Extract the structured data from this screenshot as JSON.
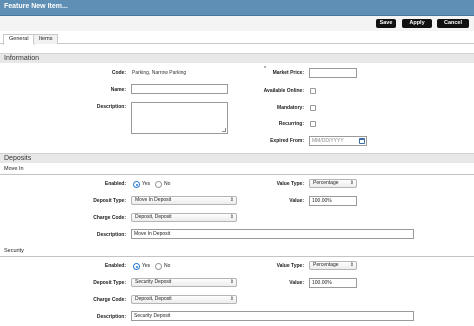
{
  "window": {
    "title": "Feature New Item..."
  },
  "toolbar": {
    "save_label": "Save",
    "apply_label": "Apply",
    "cancel_label": "Cancel"
  },
  "tabs": [
    {
      "label": "General"
    },
    {
      "label": "Items"
    }
  ],
  "information": {
    "heading": "Information",
    "code_label": "Code:",
    "code_value": "Parking, Narrow Parking",
    "name_label": "Name:",
    "name_value": "",
    "description_label": "Description:",
    "market_price_label": "Market Price:",
    "market_price_value": "",
    "available_online_label": "Available Online:",
    "mandatory_label": "Mandatory:",
    "recurring_label": "Recurring:",
    "expired_from_label": "Expired From:",
    "expired_from_placeholder": "MM/DD/YYYY"
  },
  "deposits": {
    "heading": "Deposits",
    "groups": [
      {
        "title": "Move In",
        "enabled_label": "Enabled:",
        "yes_label": "Yes",
        "no_label": "No",
        "enabled": "Yes",
        "deposit_type_label": "Deposit Type:",
        "deposit_type_value": "Move In Deposit",
        "charge_code_label": "Charge Code:",
        "charge_code_value": "Deposit, Deposit",
        "value_type_label": "Value Type:",
        "value_type_value": "Percentage",
        "value_label": "Value:",
        "value_value": "100.00%",
        "description_label": "Description:",
        "description_value": "Move In Deposit"
      },
      {
        "title": "Security",
        "enabled_label": "Enabled:",
        "yes_label": "Yes",
        "no_label": "No",
        "enabled": "Yes",
        "deposit_type_label": "Deposit Type:",
        "deposit_type_value": "Security Deposit",
        "charge_code_label": "Charge Code:",
        "charge_code_value": "Deposit, Deposit",
        "value_type_label": "Value Type:",
        "value_type_value": "Percentage",
        "value_label": "Value:",
        "value_value": "100.00%",
        "description_label": "Description:",
        "description_value": "Security Deposit"
      }
    ]
  },
  "colors": {
    "titlebar": "#5f8fb4",
    "button": "#111111",
    "radio_selected": "#2c7bd8",
    "section_band": "#e8e8e8"
  }
}
